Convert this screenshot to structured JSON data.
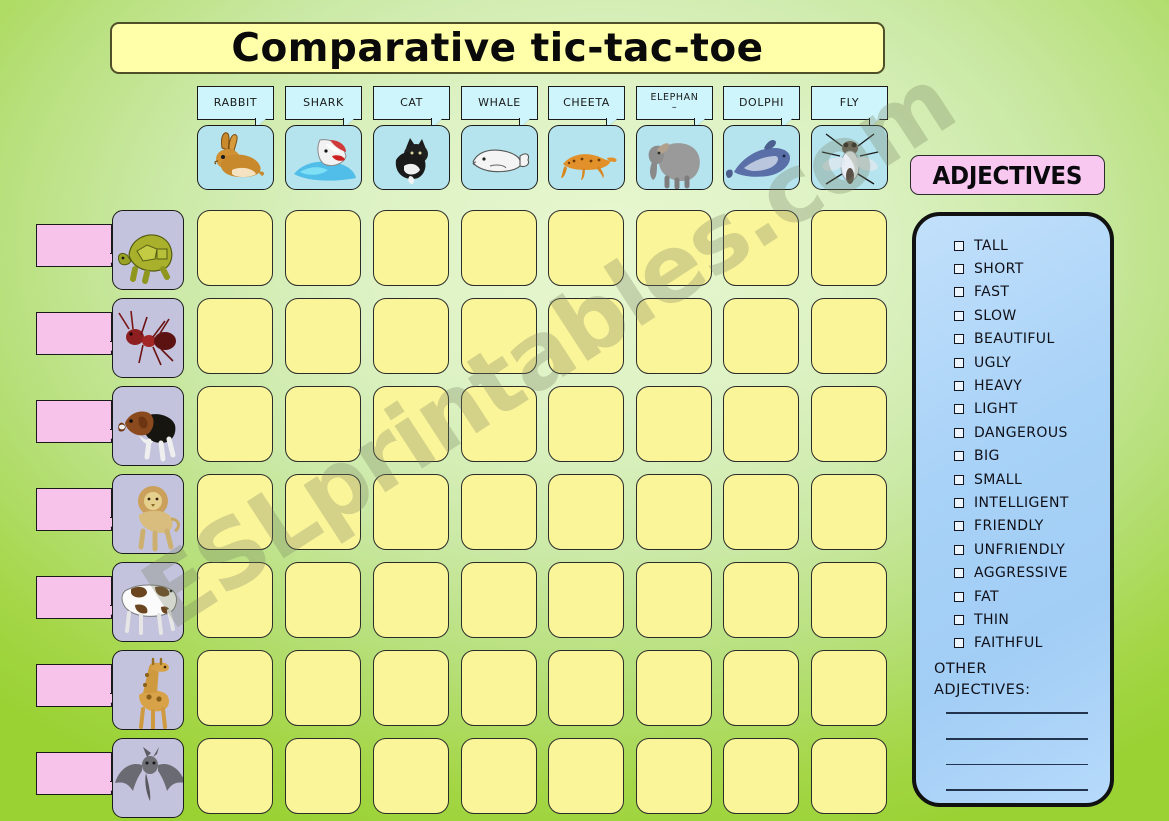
{
  "title": "Comparative tic-tac-toe",
  "watermark": "ESLprintables.com",
  "colors": {
    "background_light": "#e8f7d0",
    "background_dark": "#9ad234",
    "title_fill": "#ffffaa",
    "cell_fill": "#fbf59a",
    "column_bubble_fill": "#cdf5fb",
    "column_thumb_fill": "#b5e4ee",
    "row_bubble_fill": "#f7c3ea",
    "row_thumb_fill": "#c3c3dd",
    "adjectives_header_fill": "#f9c8f0",
    "adjectives_panel_fill": "#a8d2f7"
  },
  "columns": [
    {
      "label": "RABBIT",
      "icon": "rabbit-icon"
    },
    {
      "label": "SHARK",
      "icon": "shark-icon"
    },
    {
      "label": "CAT",
      "icon": "cat-icon"
    },
    {
      "label": "WHALE",
      "icon": "whale-icon"
    },
    {
      "label": "CHEETA",
      "icon": "cheetah-icon"
    },
    {
      "label": "ELEPHAN\n–",
      "icon": "elephant-icon"
    },
    {
      "label": "DOLPHI",
      "icon": "dolphin-icon"
    },
    {
      "label": "FLY",
      "icon": "fly-icon"
    }
  ],
  "rows": [
    {
      "label": "TORTOISE",
      "icon": "tortoise-icon"
    },
    {
      "label": "ANT",
      "icon": "ant-icon"
    },
    {
      "label": "DOG",
      "icon": "dog-icon"
    },
    {
      "label": "LION",
      "icon": "lion-icon"
    },
    {
      "label": "COW",
      "icon": "cow-icon"
    },
    {
      "label": "GIRAFF",
      "icon": "giraffe-icon"
    },
    {
      "label": "BAT",
      "icon": "bat-icon"
    }
  ],
  "adjectives_panel": {
    "header": "ADJECTIVES",
    "items": [
      "TALL",
      "SHORT",
      "FAST",
      "SLOW",
      "BEAUTIFUL",
      "UGLY",
      "HEAVY",
      "LIGHT",
      "DANGEROUS",
      "BIG",
      "SMALL",
      "INTELLIGENT",
      "FRIENDLY",
      "UNFRIENDLY",
      "AGGRESSIVE",
      "FAT",
      "THIN",
      "FAITHFUL"
    ],
    "other_line1": "OTHER",
    "other_line2": "ADJECTIVES:",
    "blank_lines": 4
  },
  "grid": {
    "columns": 8,
    "rows": 7,
    "cells_total": 56,
    "cell_value": ""
  }
}
